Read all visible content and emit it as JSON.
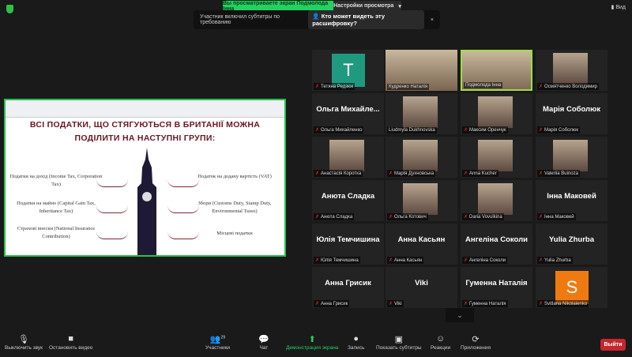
{
  "top": {
    "banner": "Вы просматриваете экран Подмолода Інна",
    "view_settings": "Настройки просмотра",
    "view": "Вид"
  },
  "toast": {
    "text": "Участник включил субтитры по требованию",
    "who": "Кто может видеть эту расшифровку?",
    "close": "×"
  },
  "slide": {
    "title1": "ВСІ ПОДАТКИ, ЩО СТЯГУЮТЬСЯ В БРИТАНІЇ МОЖНА",
    "title2": "ПОДІЛИТИ НА НАСТУПНІ ГРУПИ:",
    "left": [
      "Податки на дохід (Income Tax, Corporation Tax)",
      "Податки на майно (Capital Gain Tax, Inheritance Tax)",
      "Страхові внески (National Insurance Contribution)"
    ],
    "right": [
      "Податок на додану вартість (VAT)",
      "Збори (Customs Duty, Stamp Duty, Environmental Taxes)",
      "Місцеві податки"
    ]
  },
  "participants": [
    {
      "name": "Тетяна Редзюк",
      "type": "avatar",
      "letter": "T",
      "color": "#1f9a7e",
      "muted": true
    },
    {
      "name": "Кудренко Наталія",
      "type": "wide",
      "muted": false
    },
    {
      "name": "Подмолода Інна",
      "type": "wide",
      "muted": false,
      "active": true
    },
    {
      "name": "Осмятченко Володимир",
      "type": "photo",
      "muted": true
    },
    {
      "name": "Ольга Михайленко",
      "big": "Ольга Михайле...",
      "type": "text",
      "muted": true
    },
    {
      "name": "Liudmyla Dukhnovska",
      "type": "photo",
      "muted": false
    },
    {
      "name": "Максим Оренчук",
      "type": "photo",
      "muted": true
    },
    {
      "name": "Марія Соболюк",
      "big": "Марія Соболюк",
      "type": "text",
      "muted": true
    },
    {
      "name": "Анастасія Коротка",
      "type": "photo",
      "muted": true
    },
    {
      "name": "Марія Духновська",
      "type": "photo",
      "muted": true
    },
    {
      "name": "Anna Kucher",
      "type": "photo",
      "muted": true
    },
    {
      "name": "Valeriia Buinoza",
      "type": "photo",
      "muted": true
    },
    {
      "name": "Анюта Сладка",
      "big": "Анюта Сладка",
      "type": "text",
      "muted": true
    },
    {
      "name": "Ольга Котович",
      "type": "photo",
      "muted": true
    },
    {
      "name": "Daria Vovulkina",
      "type": "photo",
      "muted": true
    },
    {
      "name": "Інна Маковей",
      "big": "Інна Маковей",
      "type": "text",
      "muted": true
    },
    {
      "name": "Юлія Темчишина",
      "big": "Юлія  Темчишина",
      "type": "text",
      "muted": true
    },
    {
      "name": "Анна Касьян",
      "big": "Анна Касьян",
      "type": "text",
      "muted": true
    },
    {
      "name": "Ангеліна Соколи",
      "big": "Ангеліна Соколи",
      "type": "text",
      "muted": true
    },
    {
      "name": "Yulia Zhurba",
      "big": "Yulia Zhurba",
      "type": "text",
      "muted": true
    },
    {
      "name": "Анна Грисик",
      "big": "Анна Грисик",
      "type": "text",
      "muted": true
    },
    {
      "name": "Viki",
      "big": "Viki",
      "type": "text",
      "muted": true
    },
    {
      "name": "Гуменна Наталія",
      "big": "Гуменна Наталія",
      "type": "text",
      "muted": true
    },
    {
      "name": "Svitlana Nikolaienko",
      "type": "avatar",
      "letter": "S",
      "color": "#f07a12",
      "muted": true
    }
  ],
  "toolbar": {
    "mute": "Выключить звук",
    "video": "Остановить видео",
    "participants": "Участники",
    "participants_count": "29",
    "chat": "Чат",
    "share": "Демонстрация экрана",
    "record": "Запись",
    "captions": "Показать субтитры",
    "reactions": "Реакции",
    "apps": "Приложения",
    "leave": "Выйти"
  },
  "colors": {
    "accent": "#23d160",
    "leave": "#c6262e"
  }
}
